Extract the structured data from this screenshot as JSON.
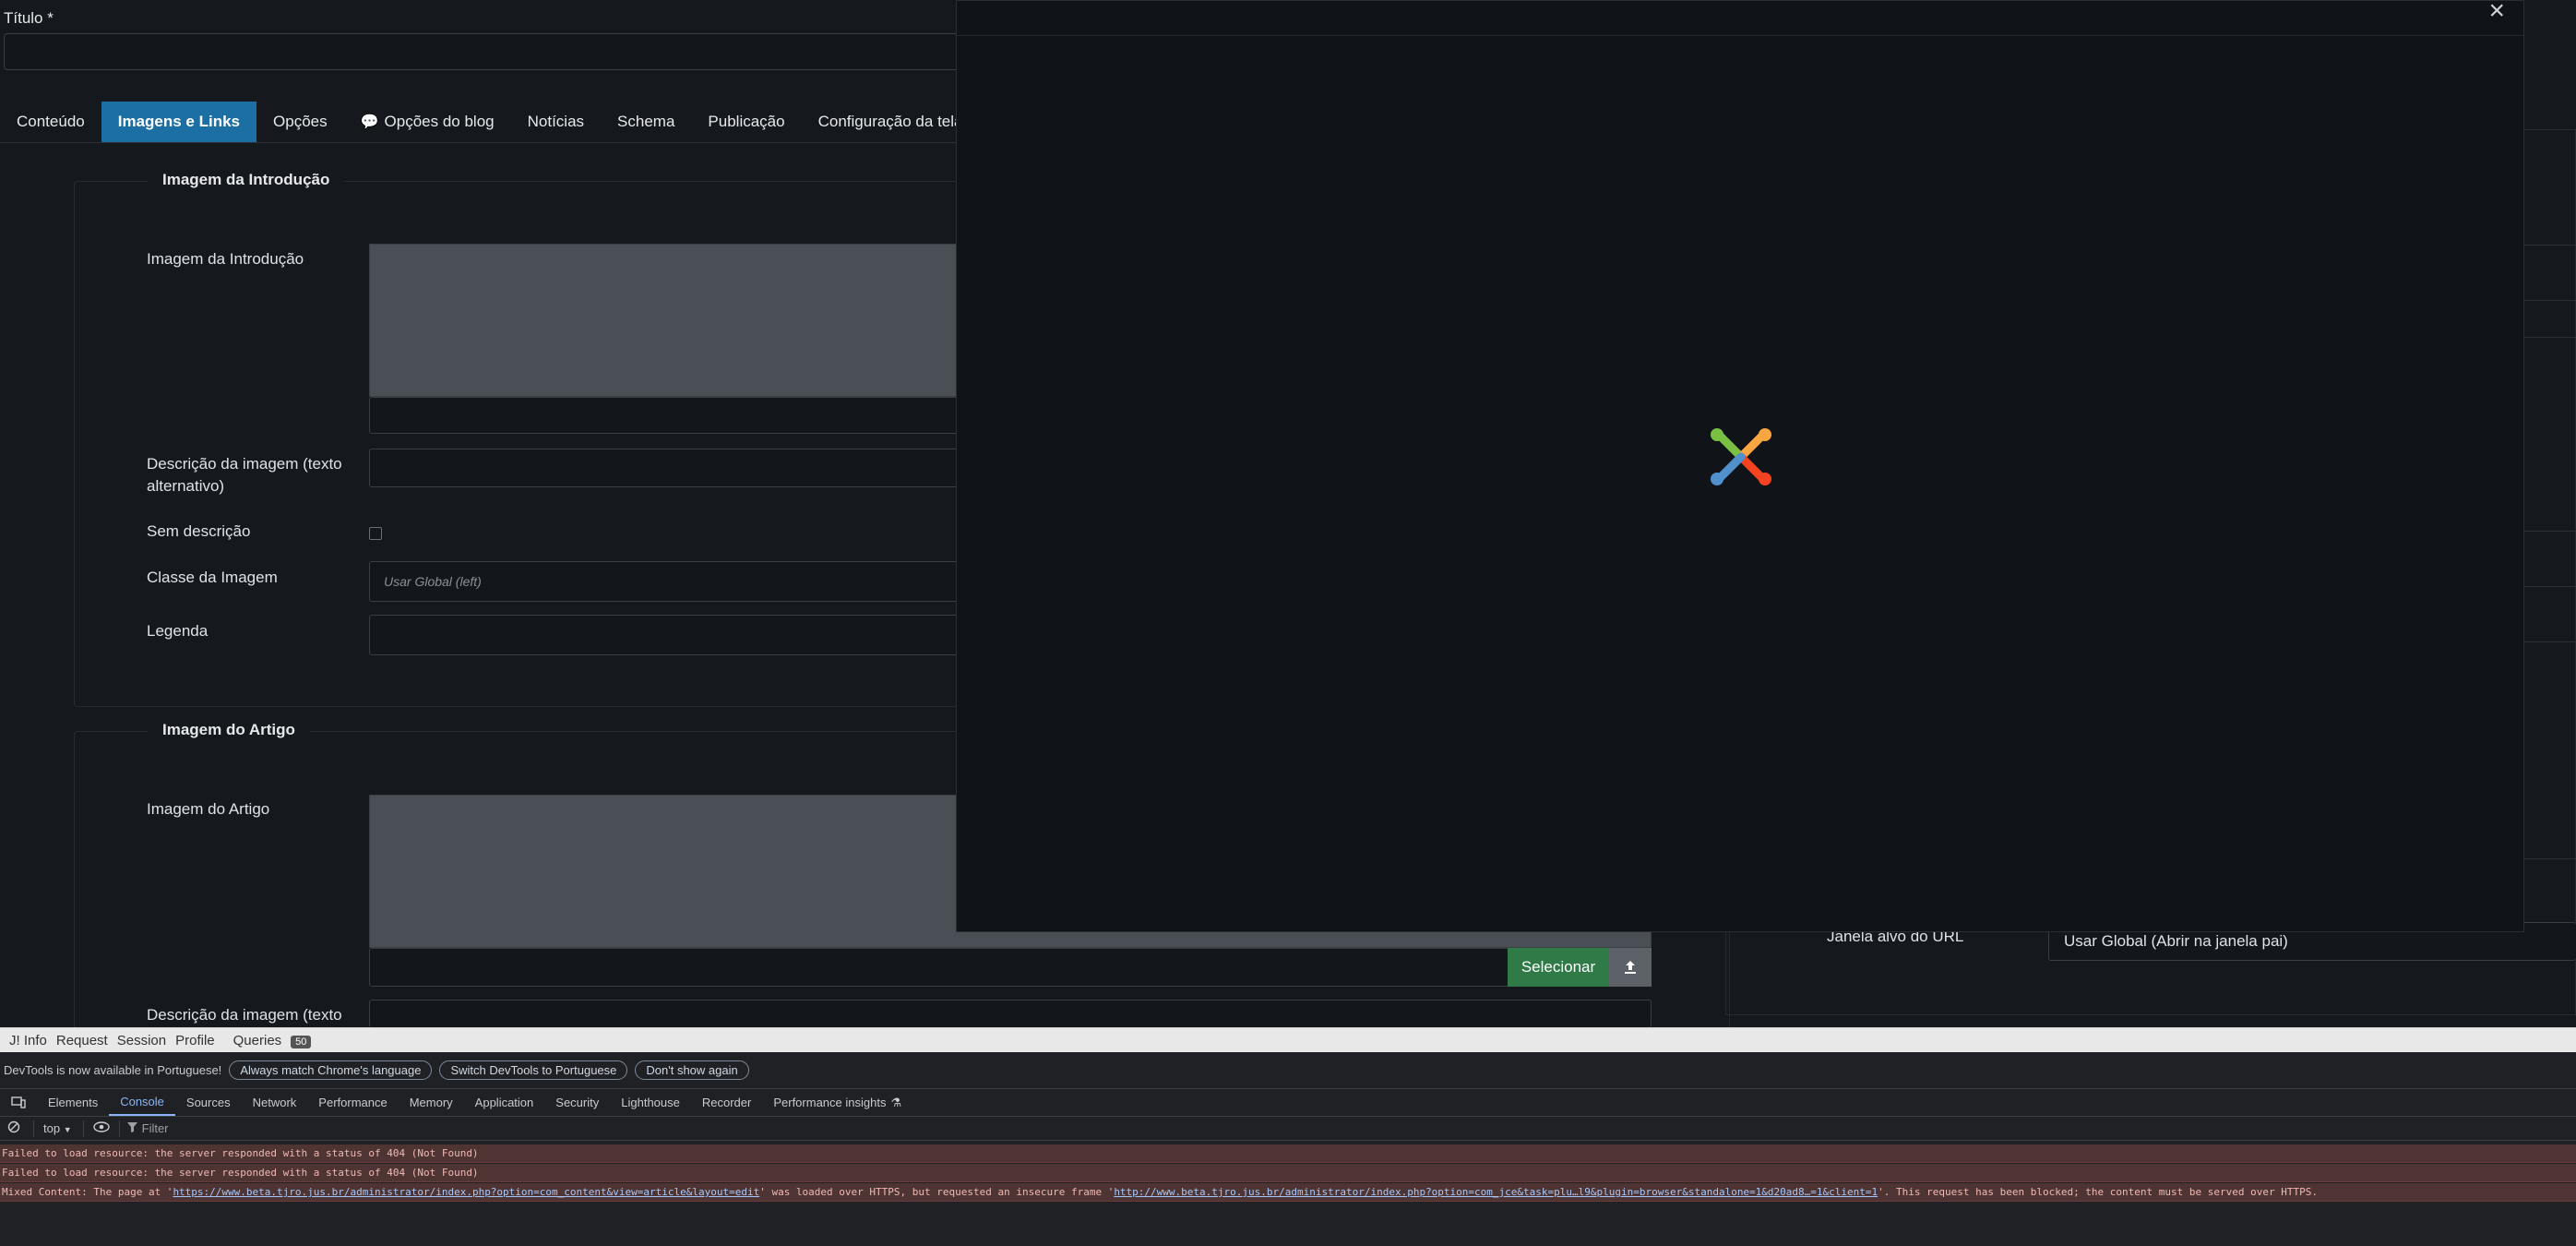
{
  "form": {
    "title_label": "Título *"
  },
  "tabs": [
    {
      "label": "Conteúdo"
    },
    {
      "label": "Imagens e Links"
    },
    {
      "label": "Opções"
    },
    {
      "label": "Opções do blog"
    },
    {
      "label": "Notícias"
    },
    {
      "label": "Schema"
    },
    {
      "label": "Publicação"
    },
    {
      "label": "Configuração da tela para ediç"
    }
  ],
  "intro": {
    "legend": "Imagem da Introdução",
    "image_label": "Imagem da Introdução",
    "alt_label": "Descrição da imagem (texto alternativo)",
    "no_desc_label": "Sem descrição",
    "class_label": "Classe da Imagem",
    "class_placeholder": "Usar Global (left)",
    "caption_label": "Legenda"
  },
  "article": {
    "legend": "Imagem do Artigo",
    "image_label": "Imagem do Artigo",
    "select_label": "Selecionar",
    "alt_label": "Descrição da imagem (texto"
  },
  "links": {
    "target_label": "Janela alvo do URL",
    "target_value": "Usar Global (Abrir na janela pai)"
  },
  "modal": {
    "close_symbol": "×"
  },
  "debugbar": {
    "items": [
      "J! Info",
      "Request",
      "Session",
      "Profile",
      "Queries"
    ],
    "queries_count": "50"
  },
  "devtools": {
    "notice": "DevTools is now available in Portuguese!",
    "btn_match": "Always match Chrome's language",
    "btn_switch": "Switch DevTools to Portuguese",
    "btn_dismiss": "Don't show again",
    "tabs": [
      "Elements",
      "Console",
      "Sources",
      "Network",
      "Performance",
      "Memory",
      "Application",
      "Security",
      "Lighthouse",
      "Recorder",
      "Performance insights"
    ],
    "context": "top",
    "filter_placeholder": "Filter",
    "console": {
      "err1": "Failed to load resource: the server responded with a status of 404 (Not Found)",
      "err2": "Failed to load resource: the server responded with a status of 404 (Not Found)",
      "mixed_prefix": "Mixed Content: The page at '",
      "mixed_url1": "https://www.beta.tjro.jus.br/administrator/index.php?option=com_content&view=article&layout=edit",
      "mixed_mid": "' was loaded over HTTPS, but requested an insecure frame '",
      "mixed_url2": "http://www.beta.tjro.jus.br/administrator/index.php?option=com_jce&task=plu…l9&plugin=browser&standalone=1&d20ad8…=1&client=1",
      "mixed_suffix": "'. This request has been blocked; the content must be served over HTTPS."
    }
  },
  "colors": {
    "active_tab": "#1b6fa3",
    "select_button": "#2f7a47"
  }
}
